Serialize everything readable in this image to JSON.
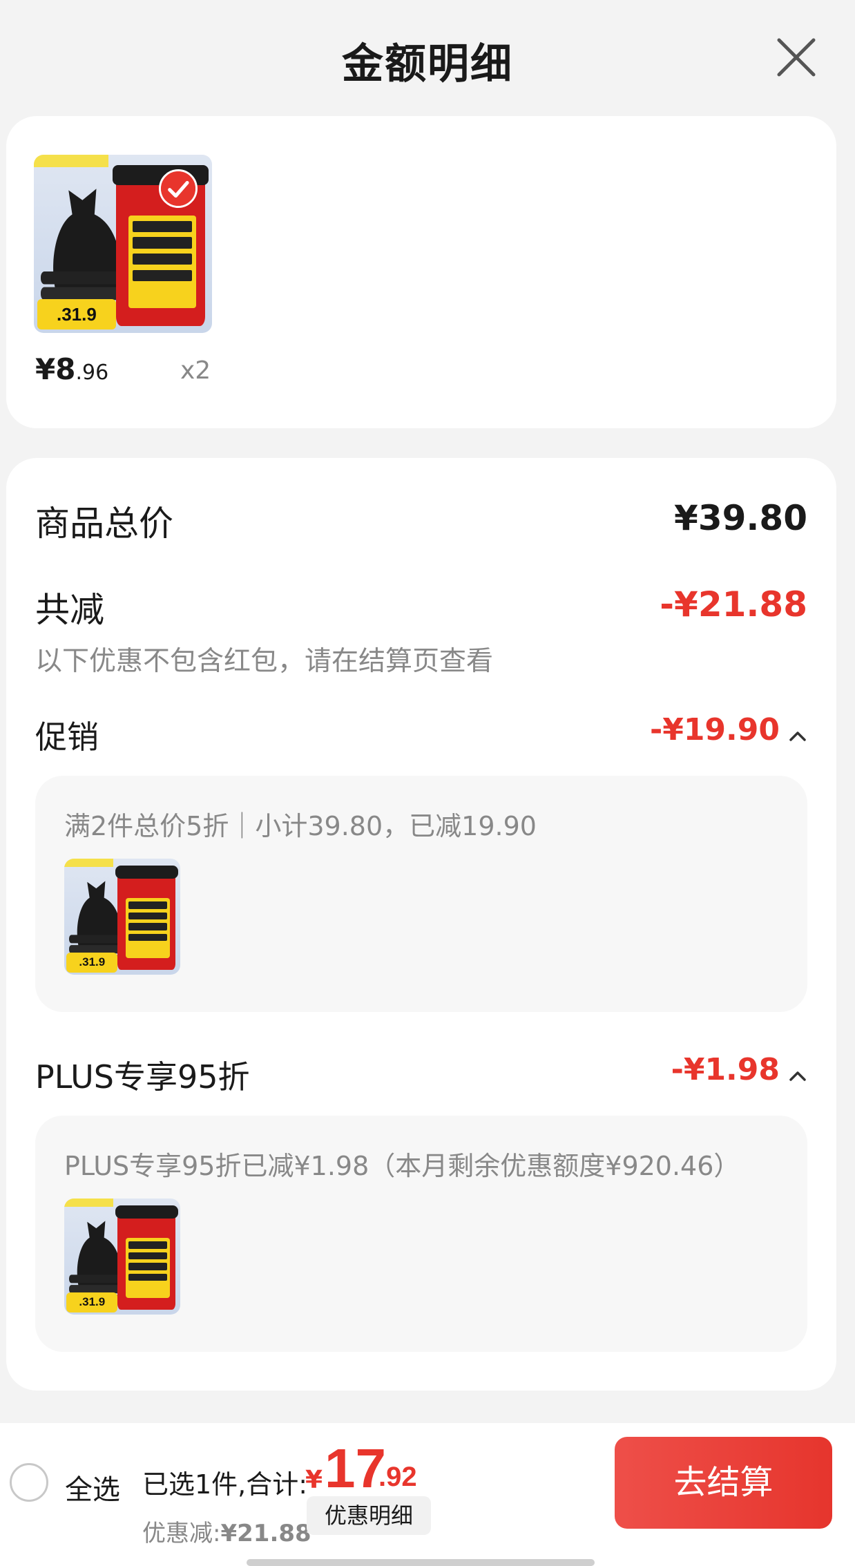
{
  "header": {
    "title": "金额明细"
  },
  "product": {
    "price_int": "¥8",
    "price_dec": ".96",
    "quantity": "x2",
    "thumb_price": ".31.9"
  },
  "summary": {
    "total_label": "商品总价",
    "total_value": "¥39.80",
    "reduce_label": "共减",
    "reduce_value": "-¥21.88",
    "note": "以下优惠不包含红包，请在结算页查看"
  },
  "promo": {
    "label": "促销",
    "value": "-¥19.90",
    "desc": "满2件总价5折｜小计39.80，已减19.90"
  },
  "plus": {
    "label": "PLUS专享95折",
    "value": "-¥1.98",
    "desc": "PLUS专享95折已减¥1.98（本月剩余优惠额度¥920.46）"
  },
  "bottom": {
    "select_all": "全选",
    "selected": "已选1件,合计:",
    "total_symbol": "¥",
    "total_int": "17",
    "total_dec": ".92",
    "discount_label": "优惠减:",
    "discount_value": "¥21.88",
    "detail_button": "优惠明细",
    "checkout_button": "去结算"
  },
  "colors": {
    "accent": "#e8352c",
    "muted": "#888888",
    "background": "#f3f3f3"
  },
  "icons": {
    "close": "close-icon",
    "chevron": "chevron-up-icon",
    "radio": "radio-unchecked-icon"
  }
}
